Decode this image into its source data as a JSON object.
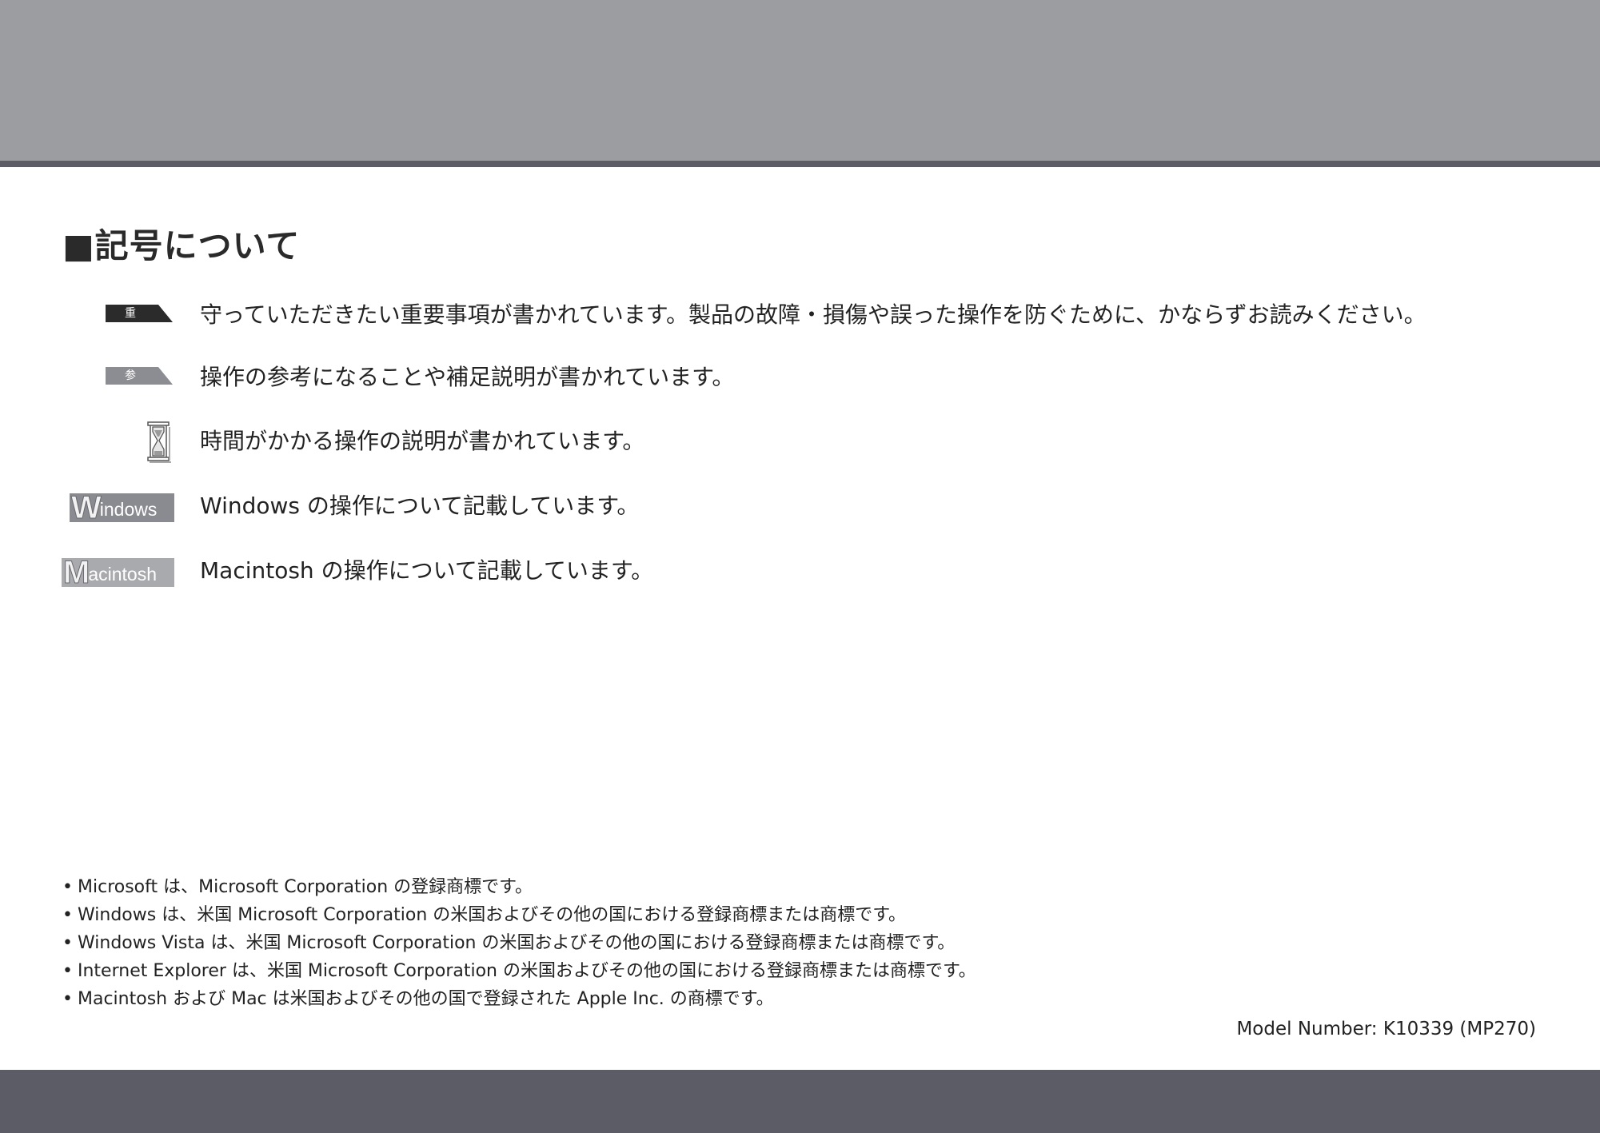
{
  "section": {
    "title": "■記号について"
  },
  "legend": [
    {
      "icon": "important-tag-icon",
      "tag_label": "重 要",
      "text": "守っていただきたい重要事項が書かれています。製品の故障・損傷や誤った操作を防ぐために、かならずお読みください。"
    },
    {
      "icon": "reference-tag-icon",
      "tag_label": "参 考",
      "text": "操作の参考になることや補足説明が書かれています。"
    },
    {
      "icon": "hourglass-icon",
      "text": "時間がかかる操作の説明が書かれています。"
    },
    {
      "icon": "windows-logo-icon",
      "logo_initial": "W",
      "logo_rest": "indows",
      "text": "Windows の操作について記載しています。"
    },
    {
      "icon": "macintosh-logo-icon",
      "logo_initial": "M",
      "logo_rest": "acintosh",
      "text": "Macintosh の操作について記載しています。"
    }
  ],
  "notes": {
    "bullet": "•",
    "items": [
      "Microsoft は、Microsoft Corporation の登録商標です。",
      "Windows は、米国 Microsoft Corporation の米国およびその他の国における登録商標または商標です。",
      "Windows Vista は、米国 Microsoft Corporation の米国およびその他の国における登録商標または商標です。",
      "Internet Explorer は、米国 Microsoft Corporation の米国およびその他の国における登録商標または商標です。",
      "Macintosh および Mac は米国およびその他の国で登録された Apple Inc. の商標です。"
    ]
  },
  "footer": {
    "model_number": "Model Number: K10339 (MP270)"
  },
  "colors": {
    "top_band": "#9c9da0",
    "band_dark": "#5c5c66",
    "important_tag": "#2b2b2b",
    "reference_tag": "#8c8d92"
  }
}
